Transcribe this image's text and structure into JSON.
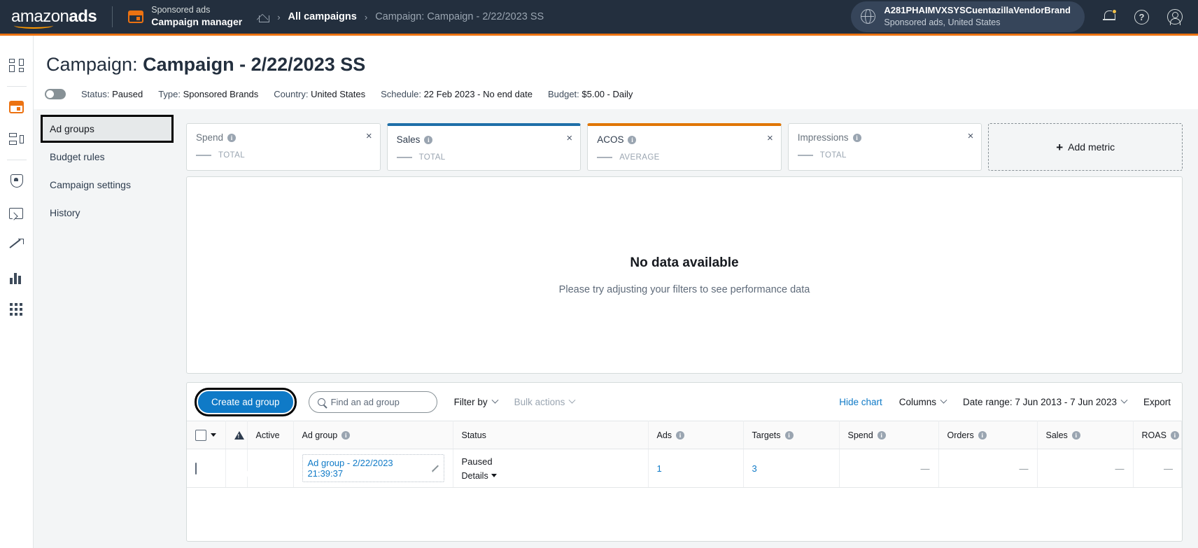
{
  "header": {
    "logo_text": "amazon",
    "logo_bold": "ads",
    "app_line1": "Sponsored ads",
    "app_line2": "Campaign manager",
    "breadcrumb": {
      "home_icon": "home-icon",
      "sep": "›",
      "all_campaigns": "All campaigns",
      "current": "Campaign: Campaign - 2/22/2023 SS"
    },
    "account": {
      "globe_icon": "globe-icon",
      "name": "A281PHAIMVXSYSCuentazillaVendorBrand",
      "sub": "Sponsored ads, United States"
    },
    "icons": {
      "notifications": "bell-icon",
      "help": "?",
      "profile": "user-icon"
    }
  },
  "rail": {
    "items": [
      {
        "name": "dashboard-icon",
        "icon": "grid-icon"
      },
      {
        "name": "campaigns-icon",
        "icon": "campaign-icon"
      },
      {
        "name": "ad-groups-icon",
        "icon": "org-icon"
      },
      {
        "name": "brand-safety-icon",
        "icon": "shield-icon"
      },
      {
        "name": "creatives-icon",
        "icon": "gallery-icon"
      },
      {
        "name": "insights-icon",
        "icon": "trend-icon"
      },
      {
        "name": "reports-icon",
        "icon": "bars-icon"
      },
      {
        "name": "apps-icon",
        "icon": "apps-icon"
      }
    ]
  },
  "page": {
    "title_prefix": "Campaign:",
    "title_name": "Campaign - 2/22/2023 SS",
    "meta": [
      {
        "label": "Status:",
        "value": "Paused"
      },
      {
        "label": "Type:",
        "value": "Sponsored Brands"
      },
      {
        "label": "Country:",
        "value": "United States"
      },
      {
        "label": "Schedule:",
        "value": "22 Feb 2023 - No end date"
      },
      {
        "label": "Budget:",
        "value": "$5.00 - Daily"
      }
    ]
  },
  "left_nav": {
    "items": [
      {
        "label": "Ad groups",
        "active": true
      },
      {
        "label": "Budget rules",
        "active": false
      },
      {
        "label": "Campaign settings",
        "active": false
      },
      {
        "label": "History",
        "active": false
      }
    ]
  },
  "metric_cards": [
    {
      "label": "Spend",
      "value": "—",
      "sub": "TOTAL",
      "accent": "none",
      "close": "×"
    },
    {
      "label": "Sales",
      "value": "—",
      "sub": "TOTAL",
      "accent": "#1e6fa8",
      "close": "×"
    },
    {
      "label": "ACOS",
      "value": "—",
      "sub": "AVERAGE",
      "accent": "#e07503",
      "close": "×"
    },
    {
      "label": "Impressions",
      "value": "—",
      "sub": "TOTAL",
      "accent": "none",
      "close": "×"
    }
  ],
  "add_metric": {
    "plus": "+",
    "label": "Add metric"
  },
  "chart": {
    "empty_title": "No data available",
    "empty_sub": "Please try adjusting your filters to see performance data"
  },
  "toolbar": {
    "create_button": "Create ad group",
    "search_placeholder": "Find an ad group",
    "search_value": "",
    "filter_by": "Filter by",
    "bulk_actions": "Bulk actions",
    "hide_chart": "Hide chart",
    "columns": "Columns",
    "date_range": "Date range: 7 Jun 2013 - 7 Jun 2023",
    "export": "Export"
  },
  "table": {
    "columns": [
      {
        "key": "select",
        "label": "",
        "info": false
      },
      {
        "key": "warn",
        "label": "",
        "info": false
      },
      {
        "key": "active",
        "label": "Active",
        "info": false
      },
      {
        "key": "adgroup",
        "label": "Ad group",
        "info": true
      },
      {
        "key": "status",
        "label": "Status",
        "info": false
      },
      {
        "key": "ads",
        "label": "Ads",
        "info": true
      },
      {
        "key": "targets",
        "label": "Targets",
        "info": true
      },
      {
        "key": "spend",
        "label": "Spend",
        "info": true
      },
      {
        "key": "orders",
        "label": "Orders",
        "info": true
      },
      {
        "key": "sales",
        "label": "Sales",
        "info": true
      },
      {
        "key": "roas",
        "label": "ROAS",
        "info": true
      }
    ],
    "rows": [
      {
        "active": true,
        "adgroup": "Ad group - 2/22/2023 21:39:37",
        "status": "Paused",
        "details": "Details",
        "ads": "1",
        "targets": "3",
        "spend": "—",
        "orders": "—",
        "sales": "—",
        "roas": "—"
      }
    ]
  }
}
